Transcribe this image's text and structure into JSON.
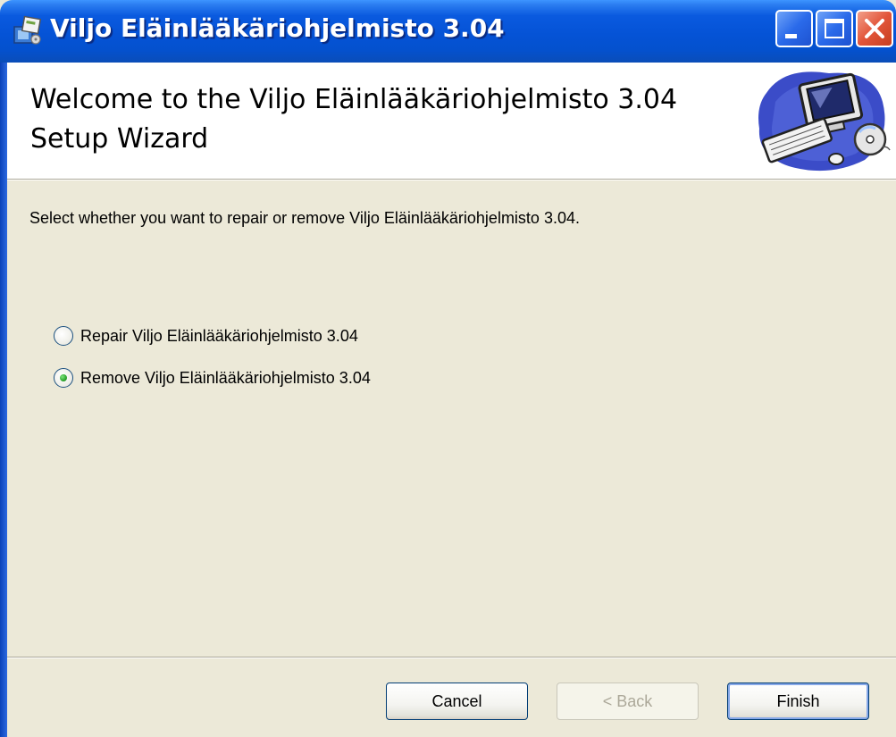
{
  "window": {
    "title": "Viljo Eläinlääkäriohjelmisto 3.04"
  },
  "banner": {
    "heading": "Welcome to the Viljo Eläinlääkäriohjelmisto 3.04 Setup Wizard"
  },
  "body": {
    "instruction": "Select whether you want to repair or remove Viljo Eläinlääkäriohjelmisto 3.04.",
    "options": [
      {
        "label": "Repair Viljo Eläinlääkäriohjelmisto 3.04",
        "selected": false
      },
      {
        "label": "Remove Viljo Eläinlääkäriohjelmisto 3.04",
        "selected": true
      }
    ]
  },
  "footer": {
    "cancel_label": "Cancel",
    "back_label": "< Back",
    "finish_label": "Finish"
  },
  "icons": {
    "title": "installer-icon",
    "banner": "computer-cd-icon",
    "minimize": "minimize-icon",
    "maximize": "maximize-icon",
    "close": "close-icon"
  },
  "colors": {
    "titlebar": "#0553D6",
    "dialog_bg": "#ECE9D8",
    "radio_checked": "#2DA52D",
    "close_button": "#E2553A"
  }
}
